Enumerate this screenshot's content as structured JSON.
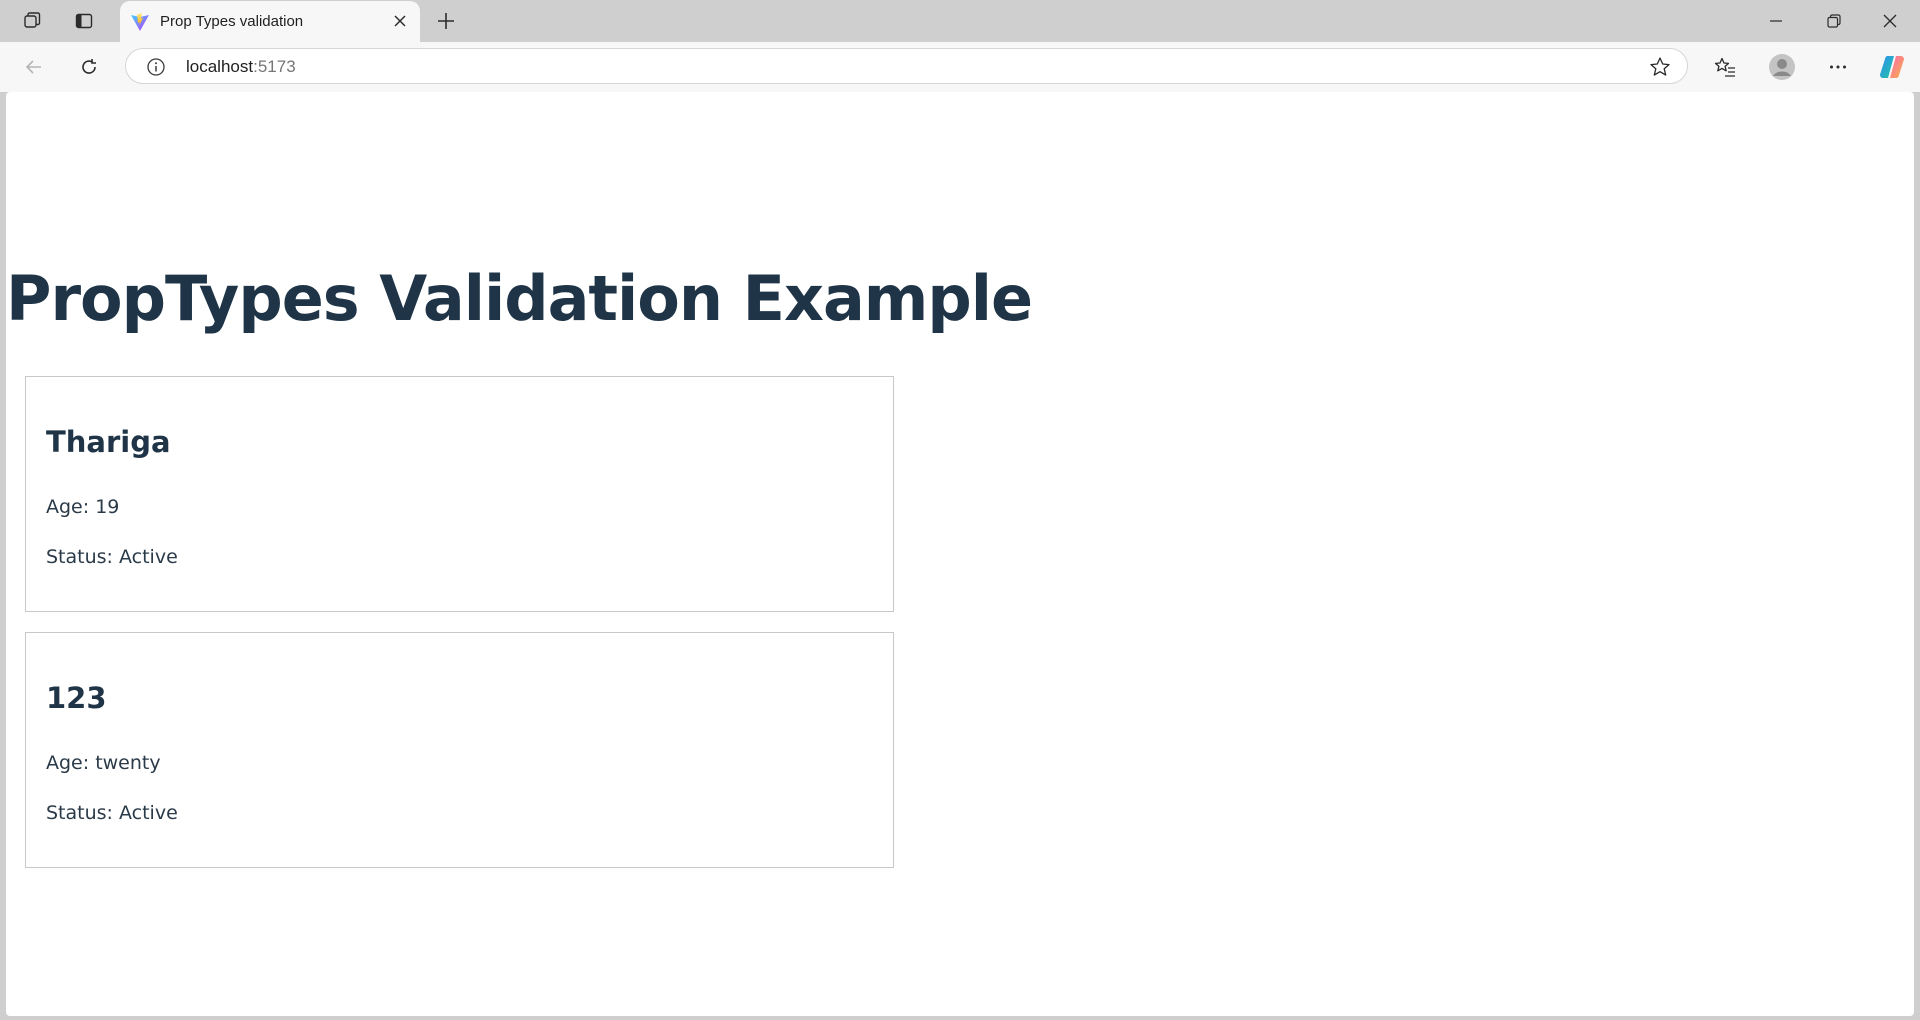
{
  "browser": {
    "tab": {
      "title": "Prop Types validation",
      "favicon": "vite-logo-icon"
    },
    "address_bar": {
      "host": "localhost",
      "port": ":5173"
    },
    "icons": {
      "workspaces": "workspaces-icon",
      "tab_actions": "tab-actions-icon",
      "close_tab": "close-icon",
      "new_tab": "plus-icon",
      "minimize": "minimize-icon",
      "restore": "restore-icon",
      "close_window": "close-icon",
      "back": "back-arrow-icon",
      "refresh": "refresh-icon",
      "site_info": "info-icon",
      "favorite": "star-icon",
      "favorites": "favorites-icon",
      "profile": "profile-icon",
      "more": "more-icon",
      "copilot": "copilot-icon"
    }
  },
  "page": {
    "heading": "PropTypes Validation Example",
    "cards": [
      {
        "name": "Thariga",
        "age_text": "Age: 19",
        "status_text": "Status: Active"
      },
      {
        "name": "123",
        "age_text": "Age: twenty",
        "status_text": "Status: Active"
      }
    ]
  },
  "colors": {
    "heading": "#1f3447",
    "text": "#2a3a48",
    "card_border": "#c8c8c8",
    "chrome_bg": "#cfcfcf",
    "toolbar_bg": "#f7f7f7"
  }
}
